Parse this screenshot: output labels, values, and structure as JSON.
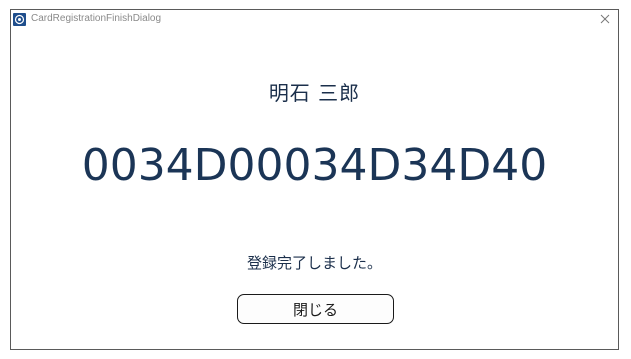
{
  "window": {
    "title": "CardRegistrationFinishDialog",
    "close_icon": "close-icon",
    "app_icon": "app-icon"
  },
  "user": {
    "name": "明石 三郎"
  },
  "card": {
    "number": "0034D00034D34D40"
  },
  "status": {
    "message": "登録完了しました。"
  },
  "buttons": {
    "close_label": "閉じる"
  },
  "colors": {
    "text_primary": "#1b2f4b",
    "card_number": "#1b3556",
    "border": "#5a5a5a"
  }
}
